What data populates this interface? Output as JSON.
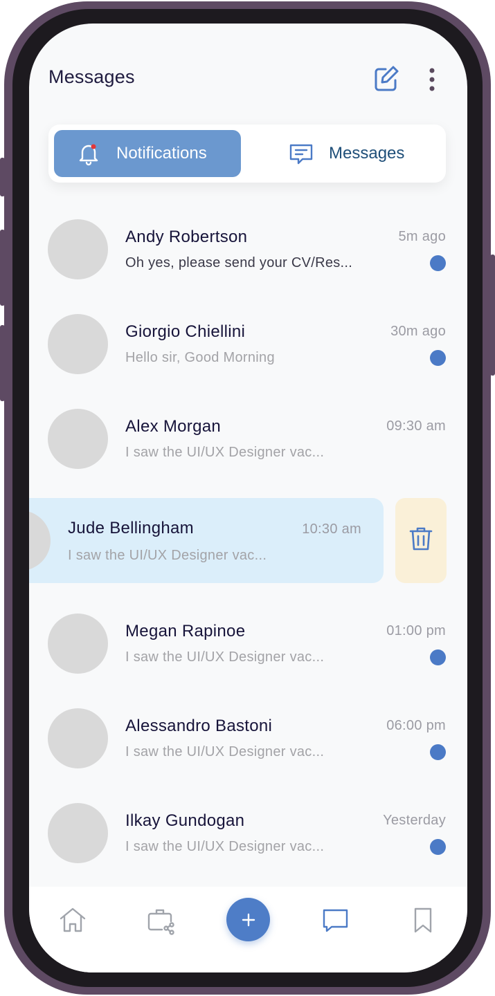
{
  "header": {
    "title": "Messages"
  },
  "tabs": [
    {
      "label": "Notifications",
      "active": true,
      "icon": "bell-icon"
    },
    {
      "label": "Messages",
      "active": false,
      "icon": "chat-icon"
    }
  ],
  "messages": [
    {
      "name": "Andy Robertson",
      "preview": "Oh yes, please send your CV/Res...",
      "time": "5m ago",
      "unread": true
    },
    {
      "name": "Giorgio Chiellini",
      "preview": "Hello sir, Good Morning",
      "time": "30m ago",
      "unread": true
    },
    {
      "name": "Alex Morgan",
      "preview": "I saw the UI/UX Designer vac...",
      "time": "09:30 am",
      "unread": false
    },
    {
      "name": "Jude Bellingham",
      "preview": "I saw the UI/UX Designer vac...",
      "time": "10:30 am",
      "unread": false
    },
    {
      "name": "Megan Rapinoe",
      "preview": "I saw the UI/UX Designer vac...",
      "time": "01:00 pm",
      "unread": true
    },
    {
      "name": "Alessandro Bastoni",
      "preview": "I saw the UI/UX Designer vac...",
      "time": "06:00 pm",
      "unread": true
    },
    {
      "name": "Ilkay Gundogan",
      "preview": "I saw the UI/UX Designer vac...",
      "time": "Yesterday",
      "unread": true
    }
  ],
  "bottom_nav": [
    {
      "icon": "home-icon"
    },
    {
      "icon": "briefcase-share-icon"
    },
    {
      "icon": "plus-icon"
    },
    {
      "icon": "chat-icon"
    },
    {
      "icon": "bookmark-icon"
    }
  ],
  "colors": {
    "accent": "#6b98cf",
    "unread_dot": "#4b7ac6",
    "swiped_row": "#dbeefa",
    "delete_bg": "#faf0d8",
    "title": "#17143a"
  }
}
